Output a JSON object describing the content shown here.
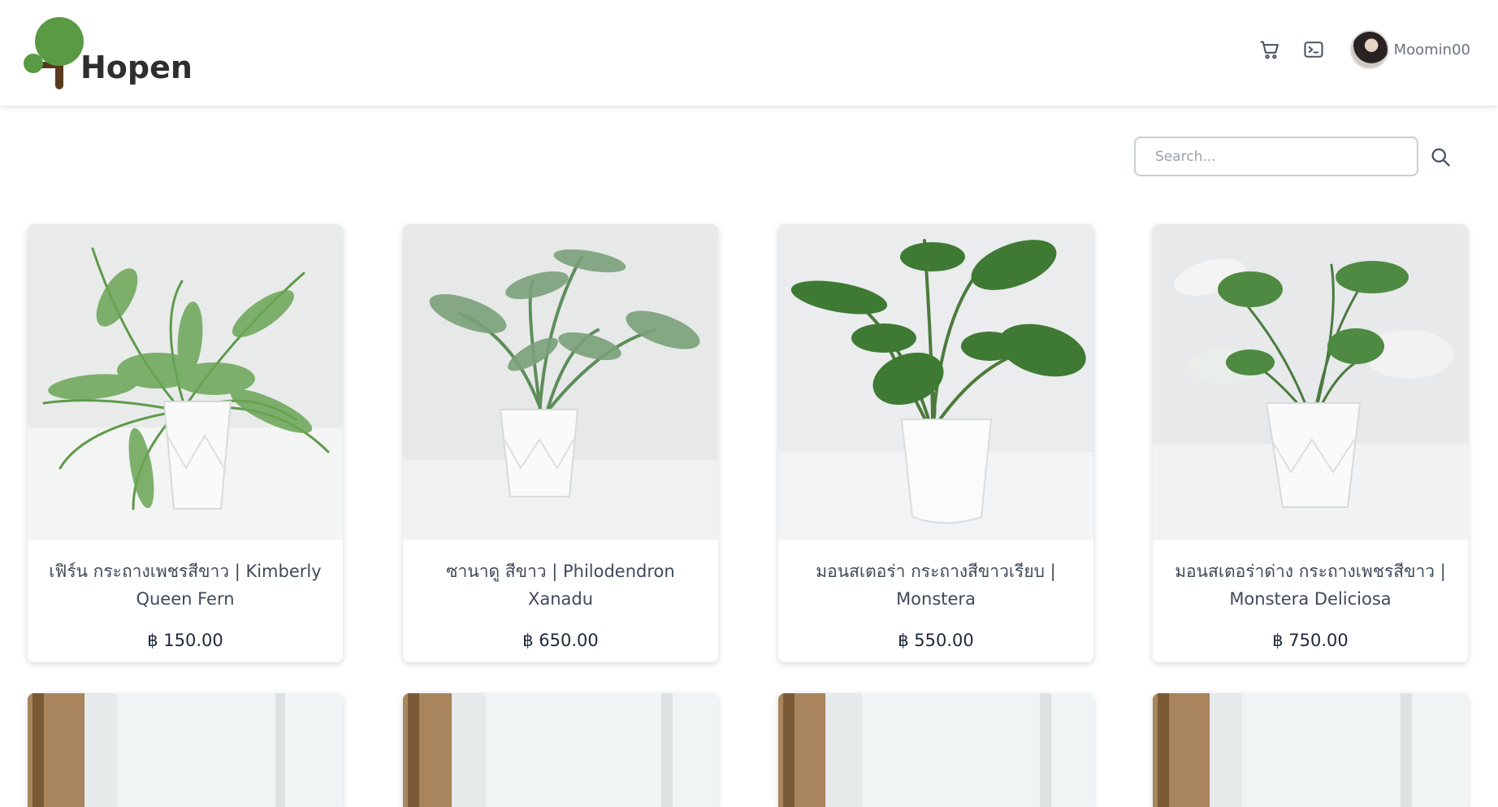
{
  "brand": {
    "name": "Hopen"
  },
  "nav": {
    "username": "Moomin00"
  },
  "search": {
    "placeholder": "Search..."
  },
  "products": [
    {
      "title": "เฟิร์น กระถางเพชรสีขาว | Kimberly Queen Fern",
      "price": "฿ 150.00"
    },
    {
      "title": "ซานาดู สีขาว | Philodendron Xanadu",
      "price": "฿ 650.00"
    },
    {
      "title": "มอนสเตอร่า กระถางสีขาวเรียบ | Monstera",
      "price": "฿ 550.00"
    },
    {
      "title": "มอนสเตอร่าด่าง กระถางเพชรสีขาว | Monstera Deliciosa",
      "price": "฿ 750.00"
    }
  ],
  "colors": {
    "brand_green": "#5a9a45",
    "trunk": "#5a3a1e",
    "text": "#3f4a5a"
  }
}
